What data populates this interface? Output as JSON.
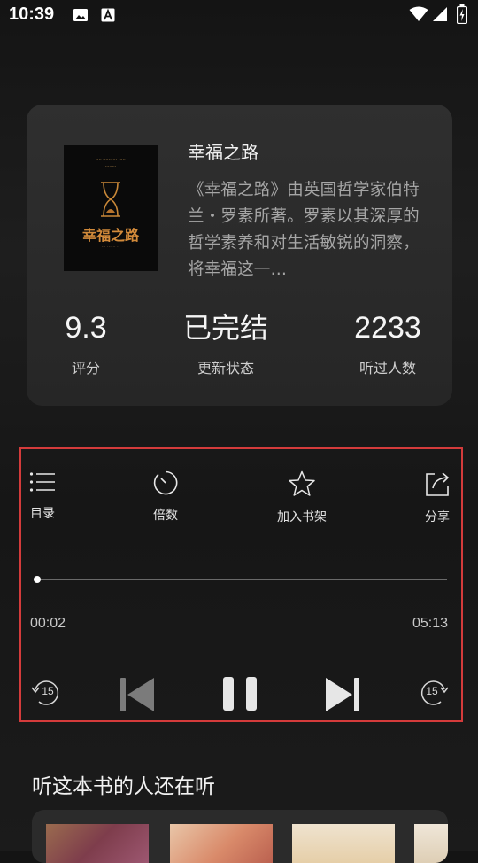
{
  "status_bar": {
    "time": "10:39"
  },
  "book": {
    "title": "幸福之路",
    "description": "《幸福之路》由英国哲学家伯特兰・罗素所著。罗素以其深厚的哲学素养和对生活敏锐的洞察，将幸福这一…",
    "cover_title": "幸福之路",
    "stats": [
      {
        "value": "9.3",
        "label": "评分"
      },
      {
        "value": "已完结",
        "label": "更新状态"
      },
      {
        "value": "2233",
        "label": "听过人数"
      }
    ]
  },
  "player": {
    "actions": [
      {
        "label": "目录",
        "icon": "list-icon"
      },
      {
        "label": "倍数",
        "icon": "speed-icon"
      },
      {
        "label": "加入书架",
        "icon": "star-icon"
      },
      {
        "label": "分享",
        "icon": "share-icon"
      }
    ],
    "current_time": "00:02",
    "total_time": "05:13",
    "progress": 0.006,
    "skip_back_seconds": "15",
    "skip_forward_seconds": "15",
    "state": "playing"
  },
  "recommend": {
    "title": "听这本书的人还在听"
  },
  "colors": {
    "highlight_border": "#d43b3b",
    "card_bg": "#2f2f2f"
  }
}
